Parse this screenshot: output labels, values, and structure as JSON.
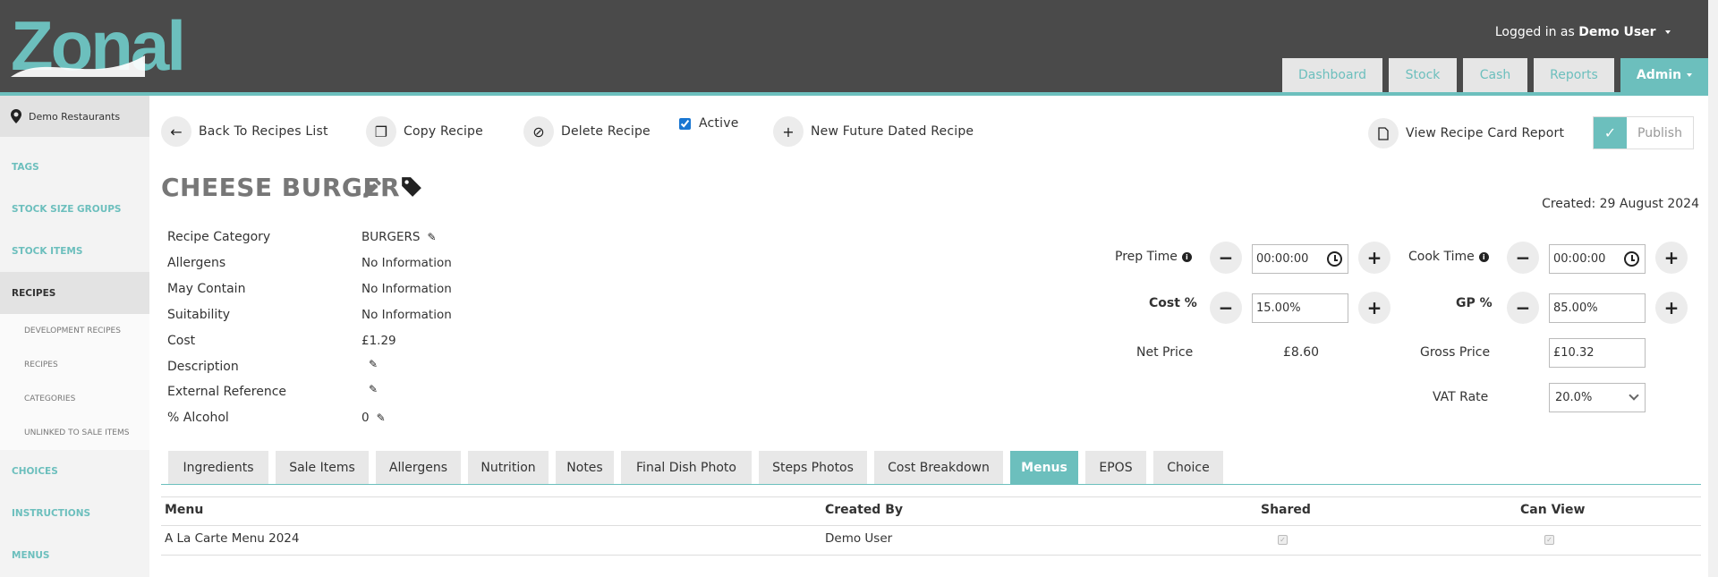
{
  "header": {
    "logo_text": "Zonal",
    "user_prefix": "Logged in as",
    "user_name": "Demo User",
    "nav": [
      {
        "label": "Dashboard"
      },
      {
        "label": "Stock"
      },
      {
        "label": "Cash"
      },
      {
        "label": "Reports"
      },
      {
        "label": "Admin"
      }
    ],
    "brand_color": "#6cbfbd"
  },
  "sidebar": {
    "location": "Demo Restaurants",
    "items": [
      {
        "label": "TAGS"
      },
      {
        "label": "STOCK SIZE GROUPS"
      },
      {
        "label": "STOCK ITEMS"
      },
      {
        "label": "RECIPES"
      },
      {
        "label": "DEVELOPMENT RECIPES"
      },
      {
        "label": "RECIPES"
      },
      {
        "label": "CATEGORIES"
      },
      {
        "label": "UNLINKED TO SALE ITEMS"
      },
      {
        "label": "CHOICES"
      },
      {
        "label": "INSTRUCTIONS"
      },
      {
        "label": "MENUS"
      }
    ]
  },
  "actions": {
    "back": "Back To Recipes List",
    "copy": "Copy Recipe",
    "delete": "Delete Recipe",
    "active": "Active",
    "new_future": "New Future Dated Recipe",
    "view_report": "View Recipe Card Report",
    "publish": "Publish"
  },
  "recipe": {
    "title": "CHEESE BURGER",
    "created": "Created: 29 August 2024",
    "details": [
      {
        "label": "Recipe Category",
        "value": "BURGERS"
      },
      {
        "label": "Allergens",
        "value": "No Information"
      },
      {
        "label": "May Contain",
        "value": "No Information"
      },
      {
        "label": "Suitability",
        "value": "No Information"
      },
      {
        "label": "Cost",
        "value": "£1.29"
      },
      {
        "label": "Description",
        "value": ""
      },
      {
        "label": "External Reference",
        "value": ""
      },
      {
        "label": "% Alcohol",
        "value": "0"
      }
    ]
  },
  "pricing": {
    "prep_time_label": "Prep Time",
    "prep_time": "00:00:00",
    "cook_time_label": "Cook Time",
    "cook_time": "00:00:00",
    "cost_pct_label": "Cost %",
    "cost_pct": "15.00%",
    "gp_pct_label": "GP %",
    "gp_pct": "85.00%",
    "net_price_label": "Net Price",
    "net_price": "£8.60",
    "gross_price_label": "Gross Price",
    "gross_price": "£10.32",
    "vat_rate_label": "VAT Rate",
    "vat_rate": "20.0%"
  },
  "tabs": [
    {
      "label": "Ingredients"
    },
    {
      "label": "Sale Items"
    },
    {
      "label": "Allergens"
    },
    {
      "label": "Nutrition"
    },
    {
      "label": "Notes"
    },
    {
      "label": "Final Dish Photo"
    },
    {
      "label": "Steps Photos"
    },
    {
      "label": "Cost Breakdown"
    },
    {
      "label": "Menus"
    },
    {
      "label": "EPOS"
    },
    {
      "label": "Choice"
    }
  ],
  "table": {
    "headers": [
      "Menu",
      "Created By",
      "Shared",
      "Can View"
    ],
    "rows": [
      {
        "menu": "A La Carte Menu 2024",
        "created_by": "Demo User",
        "shared": true,
        "can_view": true
      }
    ]
  }
}
